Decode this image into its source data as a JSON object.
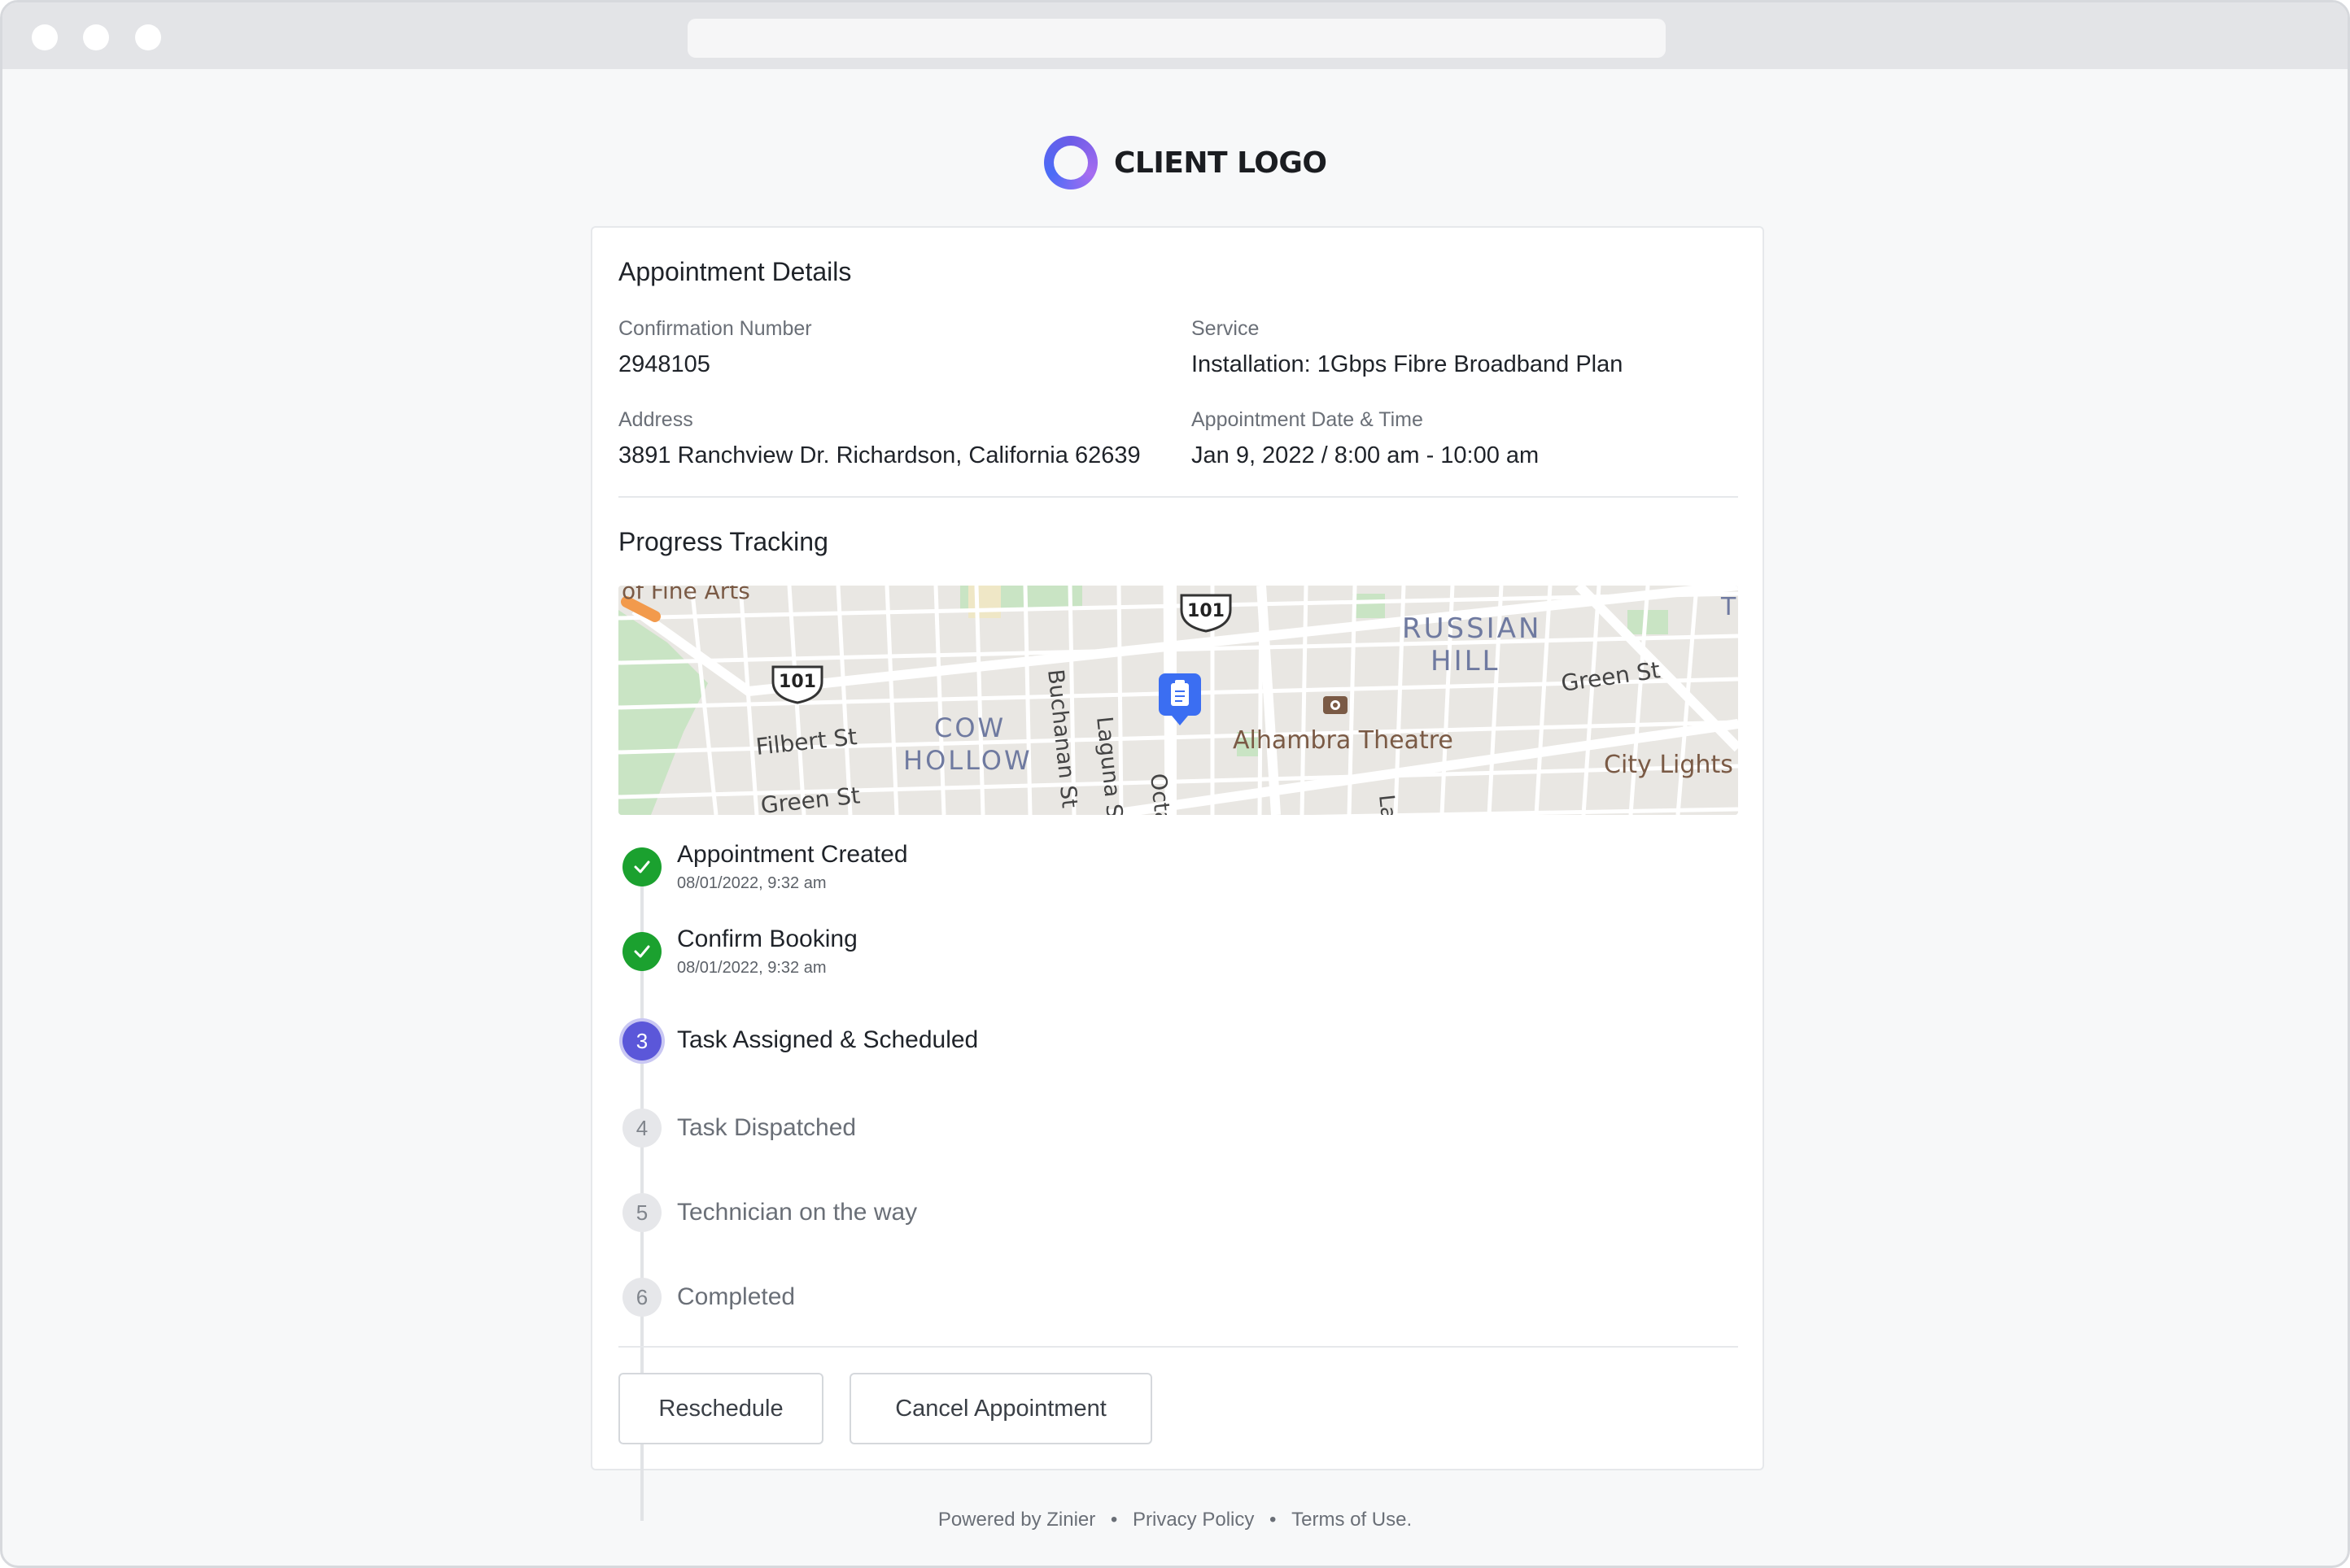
{
  "brand": {
    "logo_text": "CLIENT LOGO"
  },
  "appointment": {
    "section_title": "Appointment Details",
    "confirmation": {
      "label": "Confirmation Number",
      "value": "2948105"
    },
    "service": {
      "label": "Service",
      "value": "Installation: 1Gbps Fibre Broadband Plan"
    },
    "address": {
      "label": "Address",
      "value": "3891 Ranchview Dr. Richardson, California 62639"
    },
    "datetime": {
      "label": "Appointment Date & Time",
      "value": "Jan 9, 2022 / 8:00 am - 10:00 am"
    }
  },
  "progress": {
    "section_title": "Progress Tracking",
    "map_labels": {
      "fine_arts": "of Fine Arts",
      "shield_101_a": "101",
      "shield_101_b": "101",
      "russian": "RUSSIAN",
      "hill": "HILL",
      "cow": "COW",
      "hollow": "HOLLOW",
      "filbert": "Filbert St",
      "green_left": "Green St",
      "green_right": "Green St",
      "buchanan": "Buchanan St",
      "laguna": "Laguna S",
      "octavia": "Octa",
      "alhambra": "Alhambra Theatre",
      "city_lights": "City Lights B",
      "lar": "Lar",
      "t_edge": "T"
    },
    "steps": [
      {
        "number": "",
        "title": "Appointment Created",
        "time": "08/01/2022, 9:32 am",
        "status": "done"
      },
      {
        "number": "",
        "title": "Confirm Booking",
        "time": "08/01/2022, 9:32 am",
        "status": "done"
      },
      {
        "number": "3",
        "title": "Task Assigned & Scheduled",
        "time": "",
        "status": "active"
      },
      {
        "number": "4",
        "title": "Task Dispatched",
        "time": "",
        "status": "pending"
      },
      {
        "number": "5",
        "title": "Technician on the way",
        "time": "",
        "status": "pending"
      },
      {
        "number": "6",
        "title": "Completed",
        "time": "",
        "status": "pending"
      }
    ]
  },
  "actions": {
    "reschedule_label": "Reschedule",
    "cancel_label": "Cancel Appointment"
  },
  "footer": {
    "powered_by": "Powered by Zinier",
    "separator": "•",
    "privacy": "Privacy Policy",
    "terms": "Terms of Use."
  },
  "colors": {
    "done": "#1ba12f",
    "active": "#5b57d9",
    "pending": "#e6e7ea",
    "map_pin": "#3b6ef2"
  }
}
